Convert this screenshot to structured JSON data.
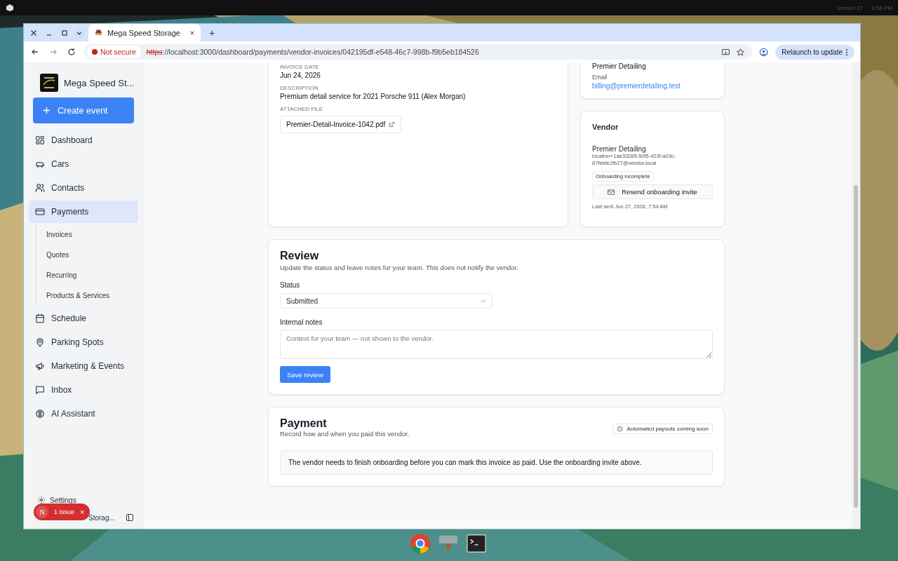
{
  "system_bar": {
    "workspace": "Section 27",
    "time": "1:56 PM"
  },
  "browser": {
    "tab_title": "Mega Speed Storage",
    "new_tab": "+",
    "security": "Not secure",
    "url_scheme": "https",
    "url_rest": "://localhost:3000/dashboard/payments/vendor-invoices/042195df-e548-46c7-998b-f9b5eb184526",
    "relaunch": "Relaunch to update"
  },
  "sidebar": {
    "brand": "Mega Speed St...",
    "create_button": "Create event",
    "items": [
      {
        "label": "Dashboard",
        "selected": false
      },
      {
        "label": "Cars",
        "selected": false
      },
      {
        "label": "Contacts",
        "selected": false
      },
      {
        "label": "Payments",
        "selected": true,
        "children": [
          {
            "label": "Invoices",
            "selected": false
          },
          {
            "label": "Quotes",
            "selected": false
          },
          {
            "label": "Recurring",
            "selected": false
          },
          {
            "label": "Products & Services",
            "selected": false
          }
        ]
      },
      {
        "label": "Schedule",
        "selected": false
      },
      {
        "label": "Parking Spots",
        "selected": false
      },
      {
        "label": "Marketing & Events",
        "selected": false
      },
      {
        "label": "Inbox",
        "selected": false
      },
      {
        "label": "AI Assistant",
        "selected": false
      }
    ],
    "settings": "Settings",
    "organization": "Storag..."
  },
  "issue_badge": {
    "avatar": "N",
    "label": "1 Issue",
    "close": "×"
  },
  "invoice": {
    "fields": [
      {
        "label": "INVOICE DATE",
        "value": "Jun 24, 2026"
      },
      {
        "label": "DESCRIPTION",
        "value": "Premium detail service for 2021 Porsche 911 (Alex Morgan)"
      }
    ],
    "attached_label": "ATTACHED FILE",
    "attached_file": "Premier-Detail-Invoice-1042.pdf"
  },
  "contact_card": {
    "name": "Premier Detailing",
    "email_label": "Email",
    "email": "billing@premierdetailing.test"
  },
  "vendor_card": {
    "title": "Vendor",
    "name": "Premier Detailing",
    "email": "location+1ae33265-50f5-423f-a03c-87febfe2fb27@vendor.local",
    "status": "Onboarding incomplete",
    "resend_button": "Resend onboarding invite",
    "last_sent": "Last sent Jun 27, 2026, 7:54 AM"
  },
  "review": {
    "title": "Review",
    "subtitle": "Update the status and leave notes for your team. This does not notify the vendor.",
    "status_label": "Status",
    "status_value": "Submitted",
    "notes_label": "Internal notes",
    "notes_placeholder": "Context for your team — not shown to the vendor.",
    "save_button": "Save review"
  },
  "payment": {
    "title": "Payment",
    "subtitle": "Record how and when you paid this vendor.",
    "badge": "Automated payouts coming soon",
    "notice": "The vendor needs to finish onboarding before you can mark this invoice as paid. Use the onboarding invite above."
  }
}
